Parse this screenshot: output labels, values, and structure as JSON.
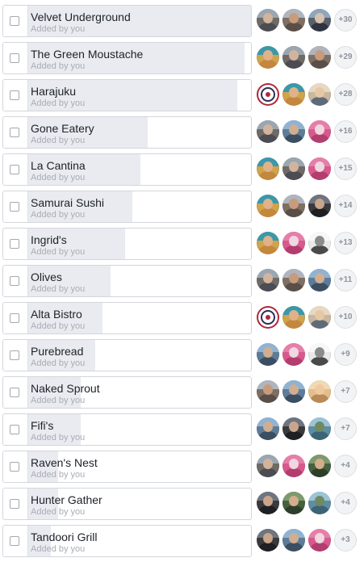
{
  "ui": {
    "added_by": "Added by you"
  },
  "options": [
    {
      "name": "Velvet Underground",
      "votes": 30,
      "more": "+30",
      "avatars": [
        "a1",
        "a2",
        "a3"
      ]
    },
    {
      "name": "The Green Moustache",
      "votes": 29,
      "more": "+29",
      "avatars": [
        "a4",
        "a1",
        "a2"
      ]
    },
    {
      "name": "Harajuku",
      "votes": 28,
      "more": "+28",
      "avatars": [
        "logo",
        "a4",
        "a5"
      ]
    },
    {
      "name": "Gone Eatery",
      "votes": 16,
      "more": "+16",
      "avatars": [
        "a1",
        "a6",
        "a7"
      ]
    },
    {
      "name": "La Cantina",
      "votes": 15,
      "more": "+15",
      "avatars": [
        "a4",
        "a1",
        "a7"
      ]
    },
    {
      "name": "Samurai Sushi",
      "votes": 14,
      "more": "+14",
      "avatars": [
        "a4",
        "a2",
        "a8"
      ]
    },
    {
      "name": "Ingrid's",
      "votes": 13,
      "more": "+13",
      "avatars": [
        "a4",
        "a7",
        "a9"
      ]
    },
    {
      "name": "Olives",
      "votes": 11,
      "more": "+11",
      "avatars": [
        "a1",
        "a2",
        "a6"
      ]
    },
    {
      "name": "Alta Bistro",
      "votes": 10,
      "more": "+10",
      "avatars": [
        "logo",
        "a4",
        "a5"
      ]
    },
    {
      "name": "Purebread",
      "votes": 9,
      "more": "+9",
      "avatars": [
        "a6",
        "a7",
        "a9"
      ]
    },
    {
      "name": "Naked Sprout",
      "votes": 7,
      "more": "+7",
      "avatars": [
        "a2",
        "a6",
        "a10"
      ]
    },
    {
      "name": "Fifi's",
      "votes": 7,
      "more": "+7",
      "avatars": [
        "a6",
        "a8",
        "a11"
      ]
    },
    {
      "name": "Raven's Nest",
      "votes": 4,
      "more": "+4",
      "avatars": [
        "a1",
        "a7",
        "a12"
      ]
    },
    {
      "name": "Hunter Gather",
      "votes": 4,
      "more": "+4",
      "avatars": [
        "a8",
        "a12",
        "a11"
      ]
    },
    {
      "name": "Tandoori Grill",
      "votes": 3,
      "more": "+3",
      "avatars": [
        "a8",
        "a6",
        "a7"
      ]
    }
  ]
}
